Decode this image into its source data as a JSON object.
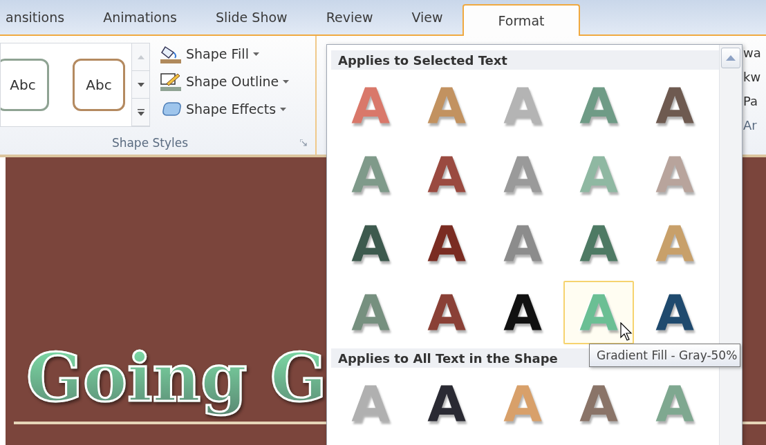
{
  "tabs": [
    {
      "label": "ansitions",
      "selected": false
    },
    {
      "label": "Animations",
      "selected": false
    },
    {
      "label": "Slide Show",
      "selected": false
    },
    {
      "label": "Review",
      "selected": false
    },
    {
      "label": "View",
      "selected": false
    },
    {
      "label": "Format",
      "selected": true
    }
  ],
  "ribbon": {
    "shape_styles": {
      "thumbnails": [
        {
          "label": "Abc",
          "color": "#8fa393"
        },
        {
          "label": "Abc",
          "color": "#b48a60"
        }
      ],
      "commands": [
        {
          "kind": "fill",
          "label": "Shape Fill"
        },
        {
          "kind": "outline",
          "label": "Shape Outline"
        },
        {
          "kind": "effects",
          "label": "Shape Effects"
        }
      ],
      "group_label": "Shape Styles"
    },
    "right_edge": [
      {
        "label": "wa",
        "kind": "command"
      },
      {
        "label": "kw",
        "kind": "command"
      },
      {
        "label": "Pa",
        "kind": "command"
      },
      {
        "label": "Ar",
        "kind": "group"
      }
    ]
  },
  "slide": {
    "title": "Going G"
  },
  "gallery": {
    "sections": [
      {
        "header": "Applies to Selected Text",
        "items": [
          {
            "letter": "A",
            "color": "#d9786a",
            "selected": false
          },
          {
            "letter": "A",
            "color": "#c29260",
            "selected": false
          },
          {
            "letter": "A",
            "color": "#b4b4b4",
            "selected": false
          },
          {
            "letter": "A",
            "color": "#6f9b86",
            "selected": false
          },
          {
            "letter": "A",
            "color": "#6e5a50",
            "selected": false
          },
          {
            "letter": "A",
            "color": "#7f9a8a",
            "selected": false
          },
          {
            "letter": "A",
            "color": "#9a4a40",
            "selected": false
          },
          {
            "letter": "A",
            "color": "#9a9a9a",
            "selected": false
          },
          {
            "letter": "A",
            "color": "#8fb8a2",
            "selected": false
          },
          {
            "letter": "A",
            "color": "#b8a49c",
            "selected": false
          },
          {
            "letter": "A",
            "color": "#3d5a4e",
            "selected": false
          },
          {
            "letter": "A",
            "color": "#7a2c22",
            "selected": false
          },
          {
            "letter": "A",
            "color": "#8c8c8c",
            "selected": false
          },
          {
            "letter": "A",
            "color": "#4e7a64",
            "selected": false
          },
          {
            "letter": "A",
            "color": "#c8a06a",
            "selected": false
          },
          {
            "letter": "A",
            "color": "#76907f",
            "selected": false
          },
          {
            "letter": "A",
            "color": "#8a4036",
            "selected": false
          },
          {
            "letter": "A",
            "color": "#111111",
            "selected": false
          },
          {
            "letter": "A",
            "color": "#6bbf94",
            "selected": true
          },
          {
            "letter": "A",
            "color": "#1f4a6e",
            "selected": false
          }
        ]
      },
      {
        "header": "Applies to All Text in the Shape",
        "items": [
          {
            "letter": "A",
            "color": "#b0b0b0",
            "selected": false
          },
          {
            "letter": "A",
            "color": "#2a2a33",
            "selected": false
          },
          {
            "letter": "A",
            "color": "#d8a06a",
            "selected": false
          },
          {
            "letter": "A",
            "color": "#8a7468",
            "selected": false
          },
          {
            "letter": "A",
            "color": "#7fa890",
            "selected": false
          }
        ]
      }
    ]
  },
  "tooltip": "Gradient Fill - Gray-50%"
}
